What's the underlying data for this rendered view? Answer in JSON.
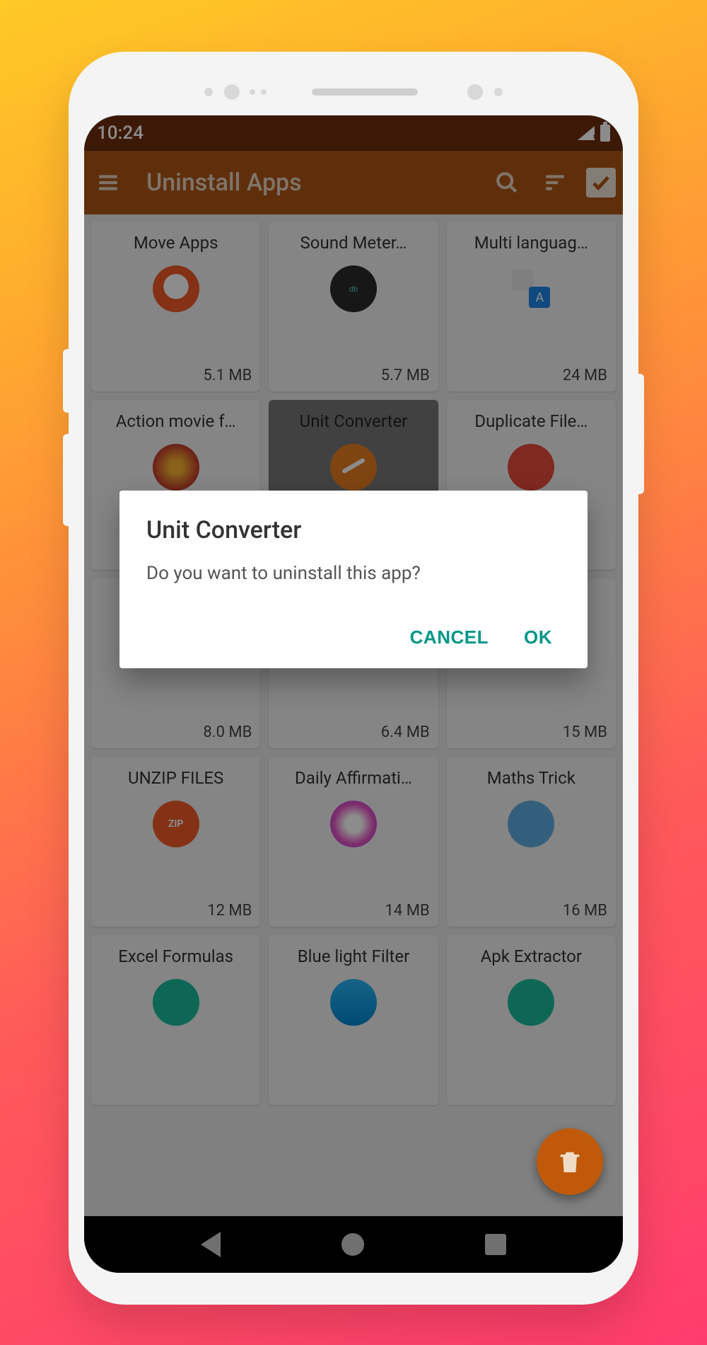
{
  "status": {
    "time": "10:24"
  },
  "toolbar": {
    "title": "Uninstall Apps"
  },
  "apps": [
    {
      "name": "Move Apps",
      "size": "5.1 MB",
      "icon": "ic-move",
      "selected": false
    },
    {
      "name": "Sound Meter…",
      "size": "5.7 MB",
      "icon": "ic-sound",
      "selected": false
    },
    {
      "name": "Multi languag…",
      "size": "24 MB",
      "icon": "ic-lang",
      "selected": false
    },
    {
      "name": "Action movie f…",
      "size": "",
      "icon": "ic-action",
      "selected": false
    },
    {
      "name": "Unit Converter",
      "size": "",
      "icon": "ic-unit",
      "selected": true
    },
    {
      "name": "Duplicate File…",
      "size": "",
      "icon": "ic-dup",
      "selected": false
    },
    {
      "name": "",
      "size": "8.0 MB",
      "icon": "",
      "selected": false
    },
    {
      "name": "",
      "size": "6.4 MB",
      "icon": "",
      "selected": false
    },
    {
      "name": "",
      "size": "15 MB",
      "icon": "",
      "selected": false
    },
    {
      "name": "UNZIP FILES",
      "size": "12 MB",
      "icon": "ic-unzip",
      "selected": false
    },
    {
      "name": "Daily Affirmati…",
      "size": "14 MB",
      "icon": "ic-affirm",
      "selected": false
    },
    {
      "name": "Maths Trick",
      "size": "16 MB",
      "icon": "ic-maths",
      "selected": false
    },
    {
      "name": "Excel Formulas",
      "size": "",
      "icon": "ic-excel",
      "selected": false
    },
    {
      "name": "Blue light Filter",
      "size": "",
      "icon": "ic-blue",
      "selected": false
    },
    {
      "name": "Apk Extractor",
      "size": "",
      "icon": "ic-apk",
      "selected": false
    }
  ],
  "dialog": {
    "title": "Unit Converter",
    "message": "Do you want to uninstall this app?",
    "cancel": "CANCEL",
    "ok": "OK"
  },
  "icons": {
    "unzip_text": "ZIP",
    "sound_text": "db"
  }
}
